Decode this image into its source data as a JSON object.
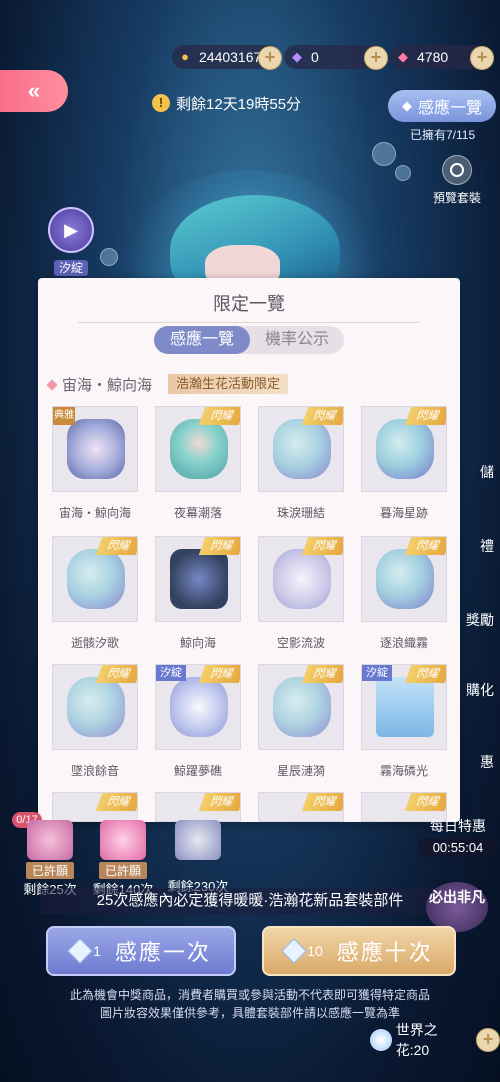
{
  "header": {
    "back_label": "«",
    "currencies": [
      {
        "icon": "cat-coin-icon",
        "value": "24403167"
      },
      {
        "icon": "purple-gem-icon",
        "value": "0"
      },
      {
        "icon": "pink-diamond-icon",
        "value": "4780"
      }
    ],
    "plus_label": "+",
    "timer_text": "剩餘12天19時55分",
    "gallery_button": "感應一覽",
    "owned_text": "已擁有7/115",
    "preview_label": "預覽套裝",
    "xiding_tag": "汐綻",
    "play_icon": "▶"
  },
  "side_labels": [
    "儲",
    "禮",
    "獎勵",
    "購化",
    "惠"
  ],
  "modal": {
    "title": "限定一覽",
    "tabs": [
      {
        "label": "感應一覽",
        "active": true
      },
      {
        "label": "機率公示",
        "active": false
      }
    ],
    "section_title": "宙海・鯨向海",
    "section_badge": "浩瀚生花活動限定",
    "ribbon_text": "閃耀",
    "xiding_text": "汐綻",
    "classic_text": "典雅",
    "items": [
      {
        "name": "宙海・鯨向海",
        "badge": "典雅"
      },
      {
        "name": "夜幕潮落",
        "badge": "閃耀"
      },
      {
        "name": "珠淚珊結",
        "badge": "閃耀"
      },
      {
        "name": "暮海星跡",
        "badge": "閃耀"
      },
      {
        "name": "逝骸汐歌",
        "badge": "閃耀"
      },
      {
        "name": "鯨向海",
        "badge": "閃耀"
      },
      {
        "name": "空影流波",
        "badge": "閃耀"
      },
      {
        "name": "逐浪織霧",
        "badge": "閃耀"
      },
      {
        "name": "墜浪餘音",
        "badge": "閃耀"
      },
      {
        "name": "鯨躍夢礁",
        "badge": "汐綻"
      },
      {
        "name": "星辰漣漪",
        "badge": "閃耀"
      },
      {
        "name": "霧海磷光",
        "badge": "汐綻"
      }
    ]
  },
  "progress_badge": "0/17",
  "rewards": [
    {
      "status": "已許願",
      "remaining": "剩餘25次"
    },
    {
      "status": "已許願",
      "remaining": "剩餘140次"
    },
    {
      "status": "",
      "remaining": "剩餘230次"
    }
  ],
  "daily": {
    "label": "每日特惠",
    "time": "00:55:04"
  },
  "guarantee_text": "25次感應內必定獲得暖暖·浩瀚花新品套裝部件",
  "must_badge": "必出非凡",
  "pull_one": {
    "count": "1",
    "label": "感應一次"
  },
  "pull_ten": {
    "count": "10",
    "label": "感應十次"
  },
  "disclaimer_1": "此為機會中獎商品，消費者購買或參與活動不代表即可獲得特定商品",
  "disclaimer_2": "圖片妝容效果僅供參考，具體套裝部件請以感應一覽為準",
  "world_flower": "世界之花:20"
}
